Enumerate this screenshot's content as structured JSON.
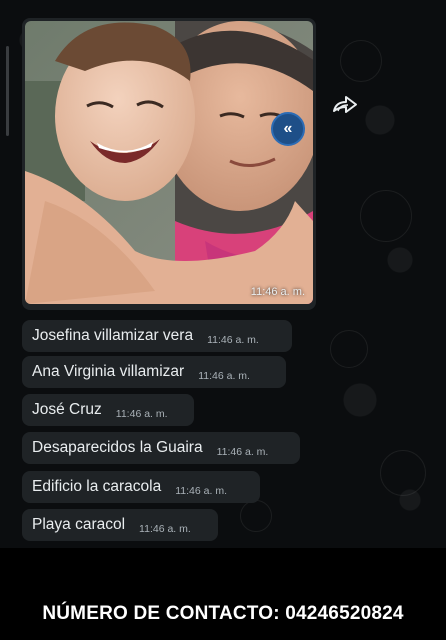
{
  "image_message": {
    "time": "11:46 a. m."
  },
  "messages": [
    {
      "text": "Josefina villamizar vera",
      "time": "11:46 a. m."
    },
    {
      "text": "Ana Virginia villamizar",
      "time": "11:46 a. m."
    },
    {
      "text": "José Cruz",
      "time": "11:46 a. m."
    },
    {
      "text": "Desaparecidos la Guaira",
      "time": "11:46 a. m."
    },
    {
      "text": "Edificio la caracola",
      "time": "11:46 a. m."
    },
    {
      "text": "Playa caracol",
      "time": "11:46 a. m."
    }
  ],
  "icons": {
    "forward": "forward-arrow-icon",
    "page_badge": "double-chevron-left-icon"
  },
  "footer": {
    "contact": "NÚMERO DE CONTACTO: 04246520824"
  },
  "colors": {
    "chat_background": "#0b0d0f",
    "bubble": "#1f2326",
    "text": "#e9edef",
    "badge": "#1e4f88"
  }
}
